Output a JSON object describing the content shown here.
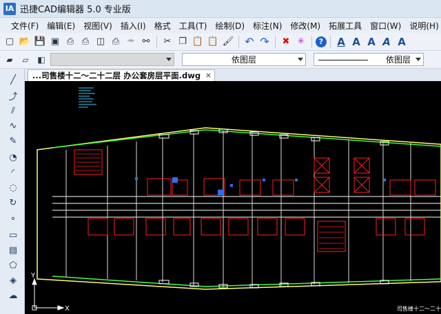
{
  "app": {
    "logo_text": "IA",
    "title": "迅捷CAD编辑器 5.0 专业版"
  },
  "menu": [
    "文件(F)",
    "编辑(E)",
    "视图(V)",
    "插入(I)",
    "格式",
    "工具(T)",
    "绘制(D)",
    "标注(N)",
    "修改(M)",
    "拓展工具",
    "窗口(W)",
    "说明(H)"
  ],
  "toolbar_icons": [
    {
      "name": "new-icon",
      "glyph": "▢"
    },
    {
      "name": "open-icon",
      "glyph": "📂"
    },
    {
      "name": "save-icon",
      "glyph": "💾"
    },
    {
      "name": "save-as-icon",
      "glyph": "▣"
    },
    {
      "name": "print-icon",
      "glyph": "⎙"
    },
    {
      "name": "print-preview-icon",
      "glyph": "⎙"
    },
    {
      "name": "page-setup-icon",
      "glyph": "◫"
    },
    {
      "name": "print-setup-icon",
      "glyph": "⎙"
    },
    {
      "name": "spellcheck-icon",
      "glyph": "ᴬᴮᶜ"
    },
    {
      "name": "find-icon",
      "glyph": "⚯"
    },
    {
      "name": "cut-icon",
      "glyph": "✂"
    },
    {
      "name": "copy-icon",
      "glyph": "❐"
    },
    {
      "name": "paste-icon",
      "glyph": "📋"
    },
    {
      "name": "paste-special-icon",
      "glyph": "📋"
    },
    {
      "name": "match-properties-icon",
      "glyph": "🖌"
    },
    {
      "name": "undo-icon",
      "glyph": "↶"
    },
    {
      "name": "redo-icon",
      "glyph": "↷"
    },
    {
      "name": "delete-icon",
      "glyph": "✖"
    },
    {
      "name": "purge-icon",
      "glyph": "✳"
    },
    {
      "name": "help-icon",
      "glyph": "?"
    },
    {
      "name": "text-icon",
      "glyph": "A"
    },
    {
      "name": "text-bold-icon",
      "glyph": "A"
    },
    {
      "name": "text-edit-icon",
      "glyph": "A"
    },
    {
      "name": "text-style-icon",
      "glyph": "A"
    },
    {
      "name": "text-scale-icon",
      "glyph": "A"
    }
  ],
  "layer_toolbar": {
    "layer_icons": [
      "layers-icon",
      "layer-state-icon",
      "layer-previous-icon"
    ],
    "layer_combo_value": "",
    "color_combo_value": "依图层",
    "linetype_combo_value": "依图层"
  },
  "draw_tools": [
    {
      "name": "line-icon",
      "glyph": "╱"
    },
    {
      "name": "polyline-icon",
      "glyph": "⤴"
    },
    {
      "name": "multiline-icon",
      "glyph": "⫽"
    },
    {
      "name": "spline-icon",
      "glyph": "∿"
    },
    {
      "name": "freehand-icon",
      "glyph": "✎"
    },
    {
      "name": "circle-icon",
      "glyph": "◔"
    },
    {
      "name": "arc-icon",
      "glyph": "◜"
    },
    {
      "name": "ellipse-icon",
      "glyph": "◌"
    },
    {
      "name": "rotate-icon",
      "glyph": "↻"
    },
    {
      "name": "point-icon",
      "glyph": "∘"
    },
    {
      "name": "rectangle-icon",
      "glyph": "▭"
    },
    {
      "name": "hatch-icon",
      "glyph": "▤"
    },
    {
      "name": "polygon-icon",
      "glyph": "⬠"
    },
    {
      "name": "region-icon",
      "glyph": "◈"
    },
    {
      "name": "revcloud-icon",
      "glyph": "☁"
    }
  ],
  "document": {
    "tab_label": "...司售楼十二～二十二层 办公套房层平面.dwg",
    "close_glyph": "×",
    "drawing_title": "司售楼十二～二十二层",
    "axis_y": "Y",
    "axis_x": "X"
  },
  "colors": {
    "canvas_bg": "#000000",
    "outline": "#ffff66",
    "walls": "#ffffff",
    "rooms": "#ff2020",
    "accent_green": "#44ff44",
    "accent_blue": "#2a6fff",
    "cyan_text": "#33ccff"
  }
}
